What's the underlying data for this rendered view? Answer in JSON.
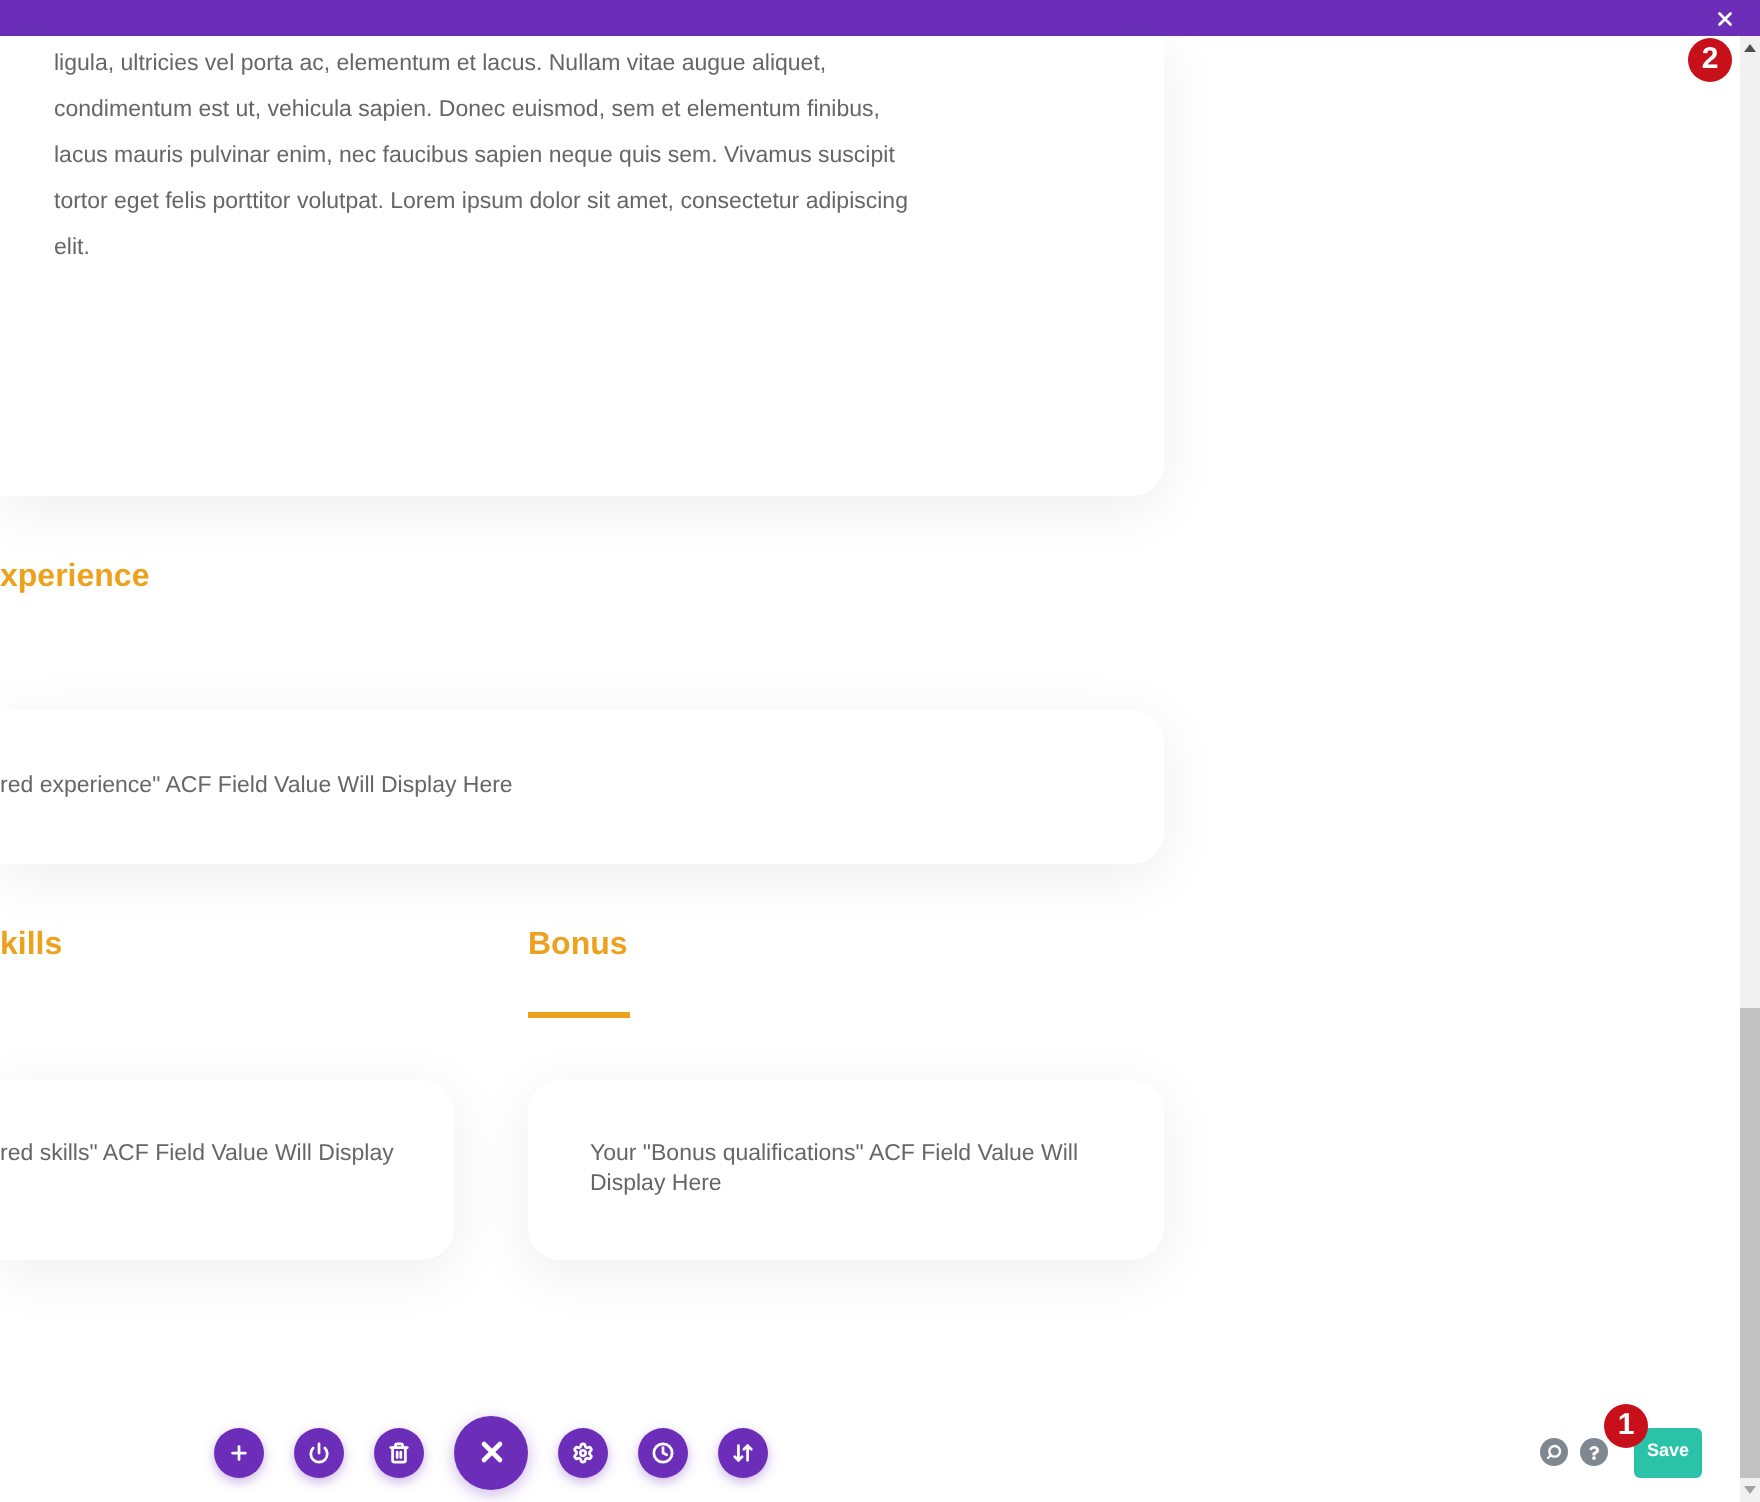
{
  "intro_card": {
    "text": "ligula, ultricies vel porta ac, elementum et lacus. Nullam vitae augue aliquet,\ncondimentum est ut, vehicula sapien. Donec euismod, sem et elementum finibus,\nlacus mauris pulvinar enim, nec faucibus sapien neque quis sem. Vivamus suscipit\ntortor eget felis porttitor volutpat. Lorem ipsum dolor sit amet, consectetur adipiscing\nelit."
  },
  "experience": {
    "heading": "xperience",
    "card_text": "red experience\" ACF Field Value Will Display Here"
  },
  "columns": [
    {
      "heading": "kills",
      "underline": false,
      "card_text": "red skills\" ACF Field Value Will Display"
    },
    {
      "heading": "Bonus",
      "underline": true,
      "card_text": "Your \"Bonus qualifications\" ACF Field Value Will Display Here"
    }
  ],
  "save_button": {
    "label": "Save"
  },
  "markers": [
    {
      "label": "2"
    },
    {
      "label": "1"
    }
  ]
}
